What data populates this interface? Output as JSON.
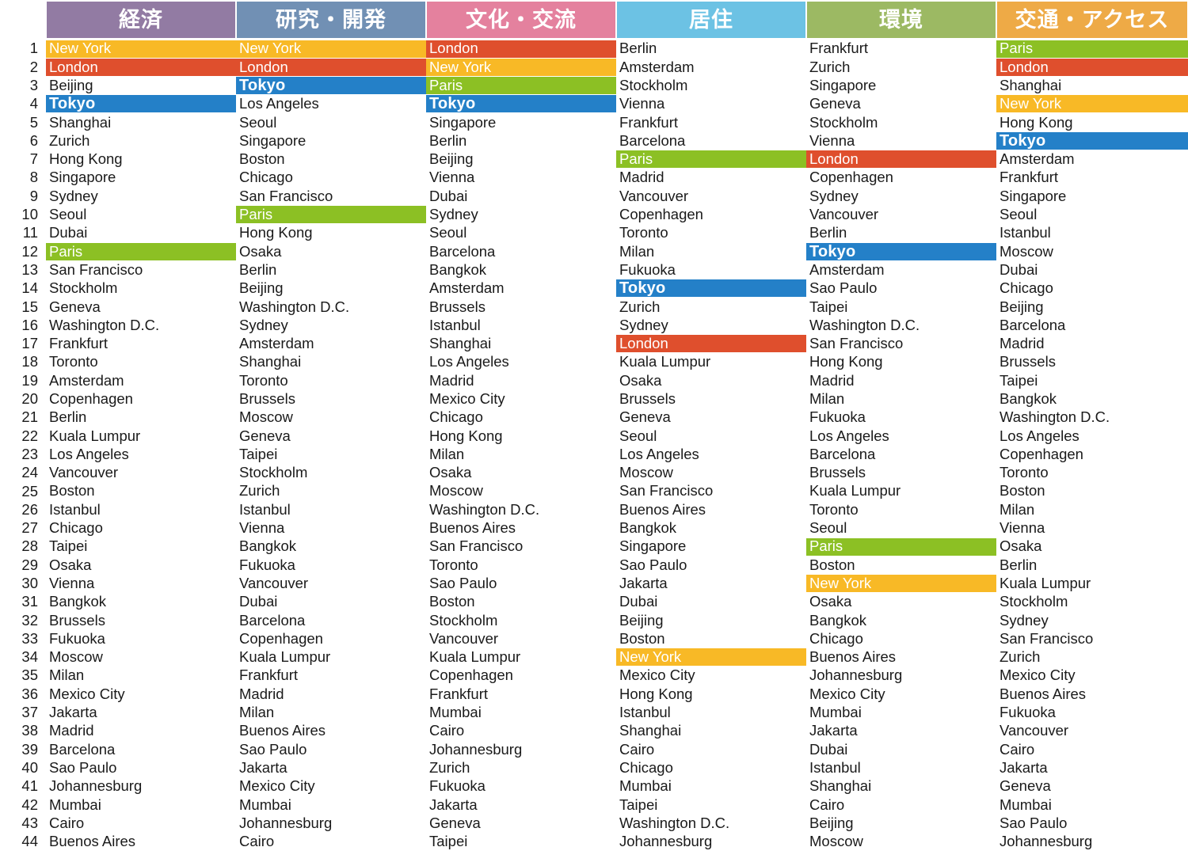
{
  "table": {
    "rank_column_header": "",
    "ranks": [
      1,
      2,
      3,
      4,
      5,
      6,
      7,
      8,
      9,
      10,
      11,
      12,
      13,
      14,
      15,
      16,
      17,
      18,
      19,
      20,
      21,
      22,
      23,
      24,
      25,
      26,
      27,
      28,
      29,
      30,
      31,
      32,
      33,
      34,
      35,
      36,
      37,
      38,
      39,
      40,
      41,
      42,
      43,
      44
    ],
    "columns": [
      {
        "header": "経済",
        "header_color": "#927ba3",
        "cells": [
          "New York",
          "London",
          "Beijing",
          "Tokyo",
          "Shanghai",
          "Zurich",
          "Hong Kong",
          "Singapore",
          "Sydney",
          "Seoul",
          "Dubai",
          "Paris",
          "San Francisco",
          "Stockholm",
          "Geneva",
          "Washington D.C.",
          "Frankfurt",
          "Toronto",
          "Amsterdam",
          "Copenhagen",
          "Berlin",
          "Kuala Lumpur",
          "Los Angeles",
          "Vancouver",
          "Boston",
          "Istanbul",
          "Chicago",
          "Taipei",
          "Osaka",
          "Vienna",
          "Bangkok",
          "Brussels",
          "Fukuoka",
          "Moscow",
          "Milan",
          "Mexico City",
          "Jakarta",
          "Madrid",
          "Barcelona",
          "Sao Paulo",
          "Johannesburg",
          "Mumbai",
          "Cairo",
          "Buenos Aires"
        ]
      },
      {
        "header": "研究・開発",
        "header_color": "#7190b4",
        "cells": [
          "New York",
          "London",
          "Tokyo",
          "Los Angeles",
          "Seoul",
          "Singapore",
          "Boston",
          "Chicago",
          "San Francisco",
          "Paris",
          "Hong Kong",
          "Osaka",
          "Berlin",
          "Beijing",
          "Washington D.C.",
          "Sydney",
          "Amsterdam",
          "Shanghai",
          "Toronto",
          "Brussels",
          "Moscow",
          "Geneva",
          "Taipei",
          "Stockholm",
          "Zurich",
          "Istanbul",
          "Vienna",
          "Bangkok",
          "Fukuoka",
          "Vancouver",
          "Dubai",
          "Barcelona",
          "Copenhagen",
          "Kuala Lumpur",
          "Frankfurt",
          "Madrid",
          "Milan",
          "Buenos Aires",
          "Sao Paulo",
          "Jakarta",
          "Mexico City",
          "Mumbai",
          "Johannesburg",
          "Cairo"
        ]
      },
      {
        "header": "文化・交流",
        "header_color": "#e4819e",
        "cells": [
          "London",
          "New York",
          "Paris",
          "Tokyo",
          "Singapore",
          "Berlin",
          "Beijing",
          "Vienna",
          "Dubai",
          "Sydney",
          "Seoul",
          "Barcelona",
          "Bangkok",
          "Amsterdam",
          "Brussels",
          "Istanbul",
          "Shanghai",
          "Los Angeles",
          "Madrid",
          "Mexico City",
          "Chicago",
          "Hong Kong",
          "Milan",
          "Osaka",
          "Moscow",
          "Washington D.C.",
          "Buenos Aires",
          "San Francisco",
          "Toronto",
          "Sao Paulo",
          "Boston",
          "Stockholm",
          "Vancouver",
          "Kuala Lumpur",
          "Copenhagen",
          "Frankfurt",
          "Mumbai",
          "Cairo",
          "Johannesburg",
          "Zurich",
          "Fukuoka",
          "Jakarta",
          "Geneva",
          "Taipei"
        ]
      },
      {
        "header": "居住",
        "header_color": "#6cc2e4",
        "cells": [
          "Berlin",
          "Amsterdam",
          "Stockholm",
          "Vienna",
          "Frankfurt",
          "Barcelona",
          "Paris",
          "Madrid",
          "Vancouver",
          "Copenhagen",
          "Toronto",
          "Milan",
          "Fukuoka",
          "Tokyo",
          "Zurich",
          "Sydney",
          "London",
          "Kuala Lumpur",
          "Osaka",
          "Brussels",
          "Geneva",
          "Seoul",
          "Los Angeles",
          "Moscow",
          "San Francisco",
          "Buenos Aires",
          "Bangkok",
          "Singapore",
          "Sao Paulo",
          "Jakarta",
          "Dubai",
          "Beijing",
          "Boston",
          "New York",
          "Mexico City",
          "Hong Kong",
          "Istanbul",
          "Shanghai",
          "Cairo",
          "Chicago",
          "Mumbai",
          "Taipei",
          "Washington D.C.",
          "Johannesburg"
        ]
      },
      {
        "header": "環境",
        "header_color": "#9cb963",
        "cells": [
          "Frankfurt",
          "Zurich",
          "Singapore",
          "Geneva",
          "Stockholm",
          "Vienna",
          "London",
          "Copenhagen",
          "Sydney",
          "Vancouver",
          "Berlin",
          "Tokyo",
          "Amsterdam",
          "Sao Paulo",
          "Taipei",
          "Washington D.C.",
          "San Francisco",
          "Hong Kong",
          "Madrid",
          "Milan",
          "Fukuoka",
          "Los Angeles",
          "Barcelona",
          "Brussels",
          "Kuala Lumpur",
          "Toronto",
          "Seoul",
          "Paris",
          "Boston",
          "New York",
          "Osaka",
          "Bangkok",
          "Chicago",
          "Buenos Aires",
          "Johannesburg",
          "Mexico City",
          "Mumbai",
          "Jakarta",
          "Dubai",
          "Istanbul",
          "Shanghai",
          "Cairo",
          "Beijing",
          "Moscow"
        ]
      },
      {
        "header": "交通・アクセス",
        "header_color": "#eeaa46",
        "cells": [
          "Paris",
          "London",
          "Shanghai",
          "New York",
          "Hong Kong",
          "Tokyo",
          "Amsterdam",
          "Frankfurt",
          "Singapore",
          "Seoul",
          "Istanbul",
          "Moscow",
          "Dubai",
          "Chicago",
          "Beijing",
          "Barcelona",
          "Madrid",
          "Brussels",
          "Taipei",
          "Bangkok",
          "Washington D.C.",
          "Los Angeles",
          "Copenhagen",
          "Toronto",
          "Boston",
          "Milan",
          "Vienna",
          "Osaka",
          "Berlin",
          "Kuala Lumpur",
          "Stockholm",
          "Sydney",
          "San Francisco",
          "Zurich",
          "Mexico City",
          "Buenos Aires",
          "Fukuoka",
          "Vancouver",
          "Cairo",
          "Jakarta",
          "Geneva",
          "Mumbai",
          "Sao Paulo",
          "Johannesburg"
        ]
      }
    ],
    "highlight_colors": {
      "New York": "#f8b926",
      "London": "#df4f2d",
      "Tokyo": "#2480c8",
      "Paris": "#8cc024"
    },
    "highlight_cities": [
      "New York",
      "London",
      "Tokyo",
      "Paris"
    ]
  }
}
